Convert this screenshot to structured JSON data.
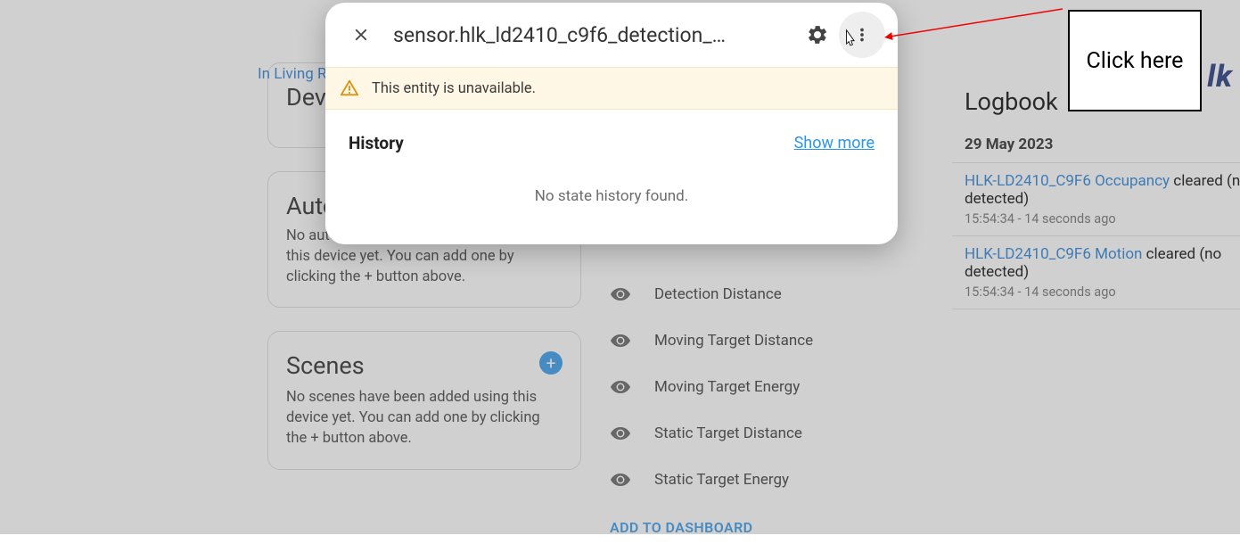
{
  "breadcrumb": "In Living Ro",
  "brand_fragment": "lk",
  "cards": {
    "device_heading": "Devic",
    "automations_heading": "Autor",
    "automations_body": "No automations have been added using this device yet. You can add one by clicking the + button above.",
    "scenes_heading": "Scenes",
    "scenes_body": "No scenes have been added using this device yet. You can add one by clicking the + button above."
  },
  "sensors": [
    "Detection Distance",
    "Moving Target Distance",
    "Moving Target Energy",
    "Static Target Distance",
    "Static Target Energy"
  ],
  "add_dashboard": "ADD TO DASHBOARD",
  "logbook": {
    "title": "Logbook",
    "date": "29 May 2023",
    "entries": [
      {
        "entity": "HLK-LD2410_C9F6 Occupancy",
        "text": " cleared (no detected)",
        "time": "15:54:34 - 14 seconds ago"
      },
      {
        "entity": "HLK-LD2410_C9F6 Motion",
        "text": " cleared (no detected)",
        "time": "15:54:34 - 14 seconds ago"
      }
    ]
  },
  "dialog": {
    "title": "sensor.hlk_ld2410_c9f6_detection_…",
    "warning": "This entity is unavailable.",
    "history_label": "History",
    "show_more": "Show more",
    "no_history": "No state history found."
  },
  "annotation": "Click here"
}
